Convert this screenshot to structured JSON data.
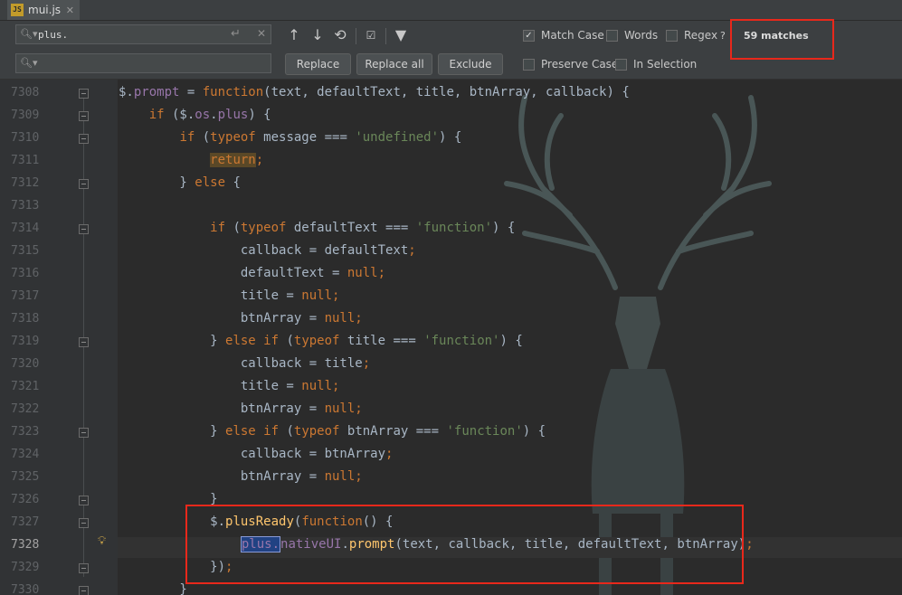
{
  "tab": {
    "icon_text": "JS",
    "filename": "mui.js"
  },
  "find": {
    "search_value": "plus.",
    "search_placeholder": "",
    "replace_value": "",
    "match_case": {
      "label": "Match Case",
      "checked": true
    },
    "words": {
      "label": "Words",
      "checked": false
    },
    "regex": {
      "label": "Regex",
      "checked": false,
      "help": "?"
    },
    "matches_text": "59 matches",
    "preserve_case": {
      "label": "Preserve Case",
      "checked": false
    },
    "in_selection": {
      "label": "In Selection",
      "checked": false
    },
    "replace_label": "Replace",
    "replace_all_label": "Replace all",
    "exclude_label": "Exclude"
  },
  "gutter": {
    "line_numbers": [
      "7308",
      "7309",
      "7310",
      "7311",
      "7312",
      "7313",
      "7314",
      "7315",
      "7316",
      "7317",
      "7318",
      "7319",
      "7320",
      "7321",
      "7322",
      "7323",
      "7324",
      "7325",
      "7326",
      "7327",
      "7328",
      "7329",
      "7330"
    ],
    "current_line": "7328"
  },
  "colors": {
    "keyword": "#cc7832",
    "string": "#6a8759",
    "property": "#9876aa",
    "function": "#ffc66d",
    "highlight_box": "#e8281b"
  },
  "code": {
    "l7308": {
      "a": "$.",
      "b": "prompt",
      "c": " = ",
      "d": "function",
      "e": "(text, defaultText, title, btnArray, callback) {"
    },
    "l7309": {
      "a": "    ",
      "b": "if",
      "c": " ($.",
      "d": "os",
      "e": ".",
      "f": "plus",
      "g": ") {"
    },
    "l7310": {
      "a": "        ",
      "b": "if",
      "c": " (",
      "d": "typeof",
      "e": " message === ",
      "f": "'undefined'",
      "g": ") {"
    },
    "l7311": {
      "a": "            ",
      "b": "return",
      "c": ";"
    },
    "l7312": {
      "a": "        } ",
      "b": "else",
      "c": " {"
    },
    "l7313": {
      "a": ""
    },
    "l7314": {
      "a": "            ",
      "b": "if",
      "c": " (",
      "d": "typeof",
      "e": " defaultText === ",
      "f": "'function'",
      "g": ") {"
    },
    "l7315": {
      "a": "                callback = defaultText",
      "b": ";"
    },
    "l7316": {
      "a": "                defaultText = ",
      "b": "null",
      "c": ";"
    },
    "l7317": {
      "a": "                title = ",
      "b": "null",
      "c": ";"
    },
    "l7318": {
      "a": "                btnArray = ",
      "b": "null",
      "c": ";"
    },
    "l7319": {
      "a": "            } ",
      "b": "else if",
      "c": " (",
      "d": "typeof",
      "e": " title === ",
      "f": "'function'",
      "g": ") {"
    },
    "l7320": {
      "a": "                callback = title",
      "b": ";"
    },
    "l7321": {
      "a": "                title = ",
      "b": "null",
      "c": ";"
    },
    "l7322": {
      "a": "                btnArray = ",
      "b": "null",
      "c": ";"
    },
    "l7323": {
      "a": "            } ",
      "b": "else if",
      "c": " (",
      "d": "typeof",
      "e": " btnArray === ",
      "f": "'function'",
      "g": ") {"
    },
    "l7324": {
      "a": "                callback = btnArray",
      "b": ";"
    },
    "l7325": {
      "a": "                btnArray = ",
      "b": "null",
      "c": ";"
    },
    "l7326": {
      "a": "            }"
    },
    "l7327": {
      "a": "            $.",
      "b": "plusReady",
      "c": "(",
      "d": "function",
      "e": "() {"
    },
    "l7328": {
      "a": "                ",
      "b": "plus.",
      "c": "nativeUI",
      "d": ".",
      "e": "prompt",
      "f": "(text, callback, title, defaultText, btnArray)",
      "g": ";"
    },
    "l7329": {
      "a": "            })",
      "b": ";"
    },
    "l7330": {
      "a": "        }"
    }
  }
}
